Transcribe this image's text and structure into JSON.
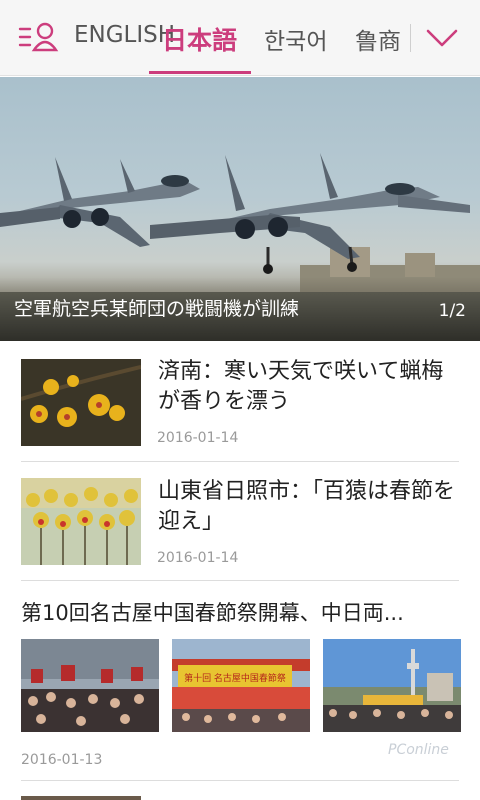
{
  "tabs": [
    "ENGLISH",
    "日本語",
    "한국어",
    "鲁商"
  ],
  "active_tab": "日本語",
  "hero": {
    "caption": "空軍航空兵某師団の戦闘機が訓練",
    "counter": "1/2"
  },
  "articles": [
    {
      "title": "済南：寒い天気で咲いて蝋梅が香りを漂う",
      "date": "2016-01-14"
    },
    {
      "title": "山東省日照市：「百猿は春節を迎え」",
      "date": "2016-01-14"
    }
  ],
  "gallery": {
    "title": "第10回名古屋中国春節祭開幕、中日両...",
    "banner_text": "第十回 名古屋中国春節祭",
    "date": "2016-01-13"
  },
  "watermark": "PConline",
  "colors": {
    "accent": "#cc3d7d",
    "date": "#9a9a9a"
  },
  "icons": {
    "user": "user-list-icon",
    "more": "chevron-down-icon"
  }
}
